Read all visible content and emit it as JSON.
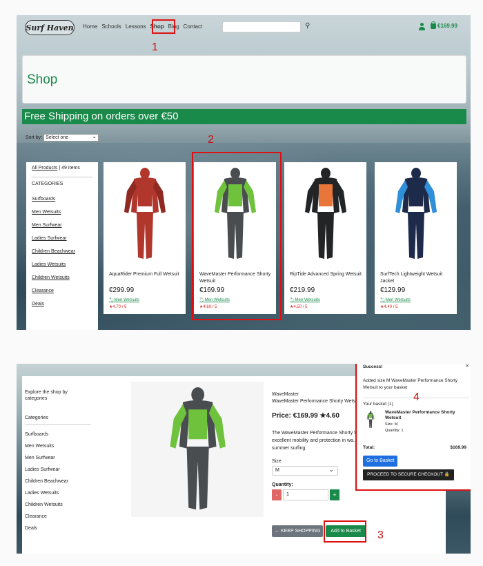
{
  "nav": {
    "logo": "Surf Haven",
    "links": [
      "Home",
      "Schools",
      "Lessons",
      "Shop",
      "Blog",
      "Contact"
    ],
    "basket_total": "€169.99"
  },
  "markers": [
    "1",
    "2",
    "3",
    "4"
  ],
  "shop": {
    "title": "Shop",
    "shipping": "Free Shipping on orders over €50",
    "sort_label": "Sort by:",
    "sort_value": "Select one"
  },
  "sidebar1": {
    "all_products": "All Products",
    "count": "| 49 Items",
    "categories_heading": "CATEGORIES",
    "items": [
      "Surfboards",
      "Men Wetsuits",
      "Men Surfwear",
      "Ladies Surfwear",
      "Children Beachwear",
      "Ladies Wetsuits",
      "Children Wetsuits",
      "Clearance",
      "Deals"
    ]
  },
  "products": [
    {
      "name": "AquaRider Premium Full Wetsuit",
      "price": "€299.99",
      "category": "Men Wetsuits",
      "rating": "4.70 / 5",
      "colors": {
        "body": "#b1362c",
        "accent": "#8f2a22",
        "panel": "#b1362c"
      }
    },
    {
      "name": "WaveMaster Performance Shorty Wetsuit",
      "price": "€169.99",
      "category": "Men Wetsuits",
      "rating": "4.60 / 5",
      "colors": {
        "body": "#4a4d50",
        "accent": "#6ec23c",
        "panel": "#6ec23c"
      }
    },
    {
      "name": "RipTide Advanced Spring Wetsuit",
      "price": "€219.99",
      "category": "Men Wetsuits",
      "rating": "4.50 / 5",
      "colors": {
        "body": "#222426",
        "accent": "#222426",
        "panel": "#e8763a"
      }
    },
    {
      "name": "SurfTech Lightweight Wetsuit Jacket",
      "price": "€129.99",
      "category": "Men Wetsuits",
      "rating": "4.40 / 5",
      "colors": {
        "body": "#1d2a4a",
        "accent": "#2f8fd8",
        "panel": "#1d2a4a"
      }
    }
  ],
  "detail": {
    "explore": "Explore the shop by categories",
    "categories_label": "Categories",
    "categories": [
      "Surfboards",
      "Men Wetsuits",
      "Men Surfwear",
      "Ladies Surfwear",
      "Children Beachwear",
      "Ladies Wetsuits",
      "Children Wetsuits",
      "Clearance",
      "Deals"
    ],
    "brand": "WaveMaster",
    "title": "WaveMaster Performance Shorty Wetsuit",
    "price": "Price: €169.99",
    "rating": "4.60",
    "description": "The WaveMaster Performance Shorty W... excellent mobility and protection in wa... for summer surfing.",
    "size_label": "Size",
    "size_value": "M",
    "qty_label": "Quantity:",
    "qty_value": "1",
    "minus": "-",
    "plus": "+",
    "keep_shopping": "← KEEP SHOPPING",
    "add_to_basket": "Add to Basket"
  },
  "popup": {
    "title": "Success!",
    "close": "×",
    "message": "Added size M WaveMaster Performance Shorty Wetsuit to your basket",
    "your_basket": "Your basket (1)",
    "item_name": "WaveMaster Performance Shorty Wetsuit",
    "item_size": "Size: M",
    "item_qty": "Quantity: 1",
    "total_label": "Total:",
    "total_value": "$169.99",
    "go_to_basket": "Go to Basket",
    "checkout": "PROCEED TO SECURE CHECKOUT 🔒"
  }
}
